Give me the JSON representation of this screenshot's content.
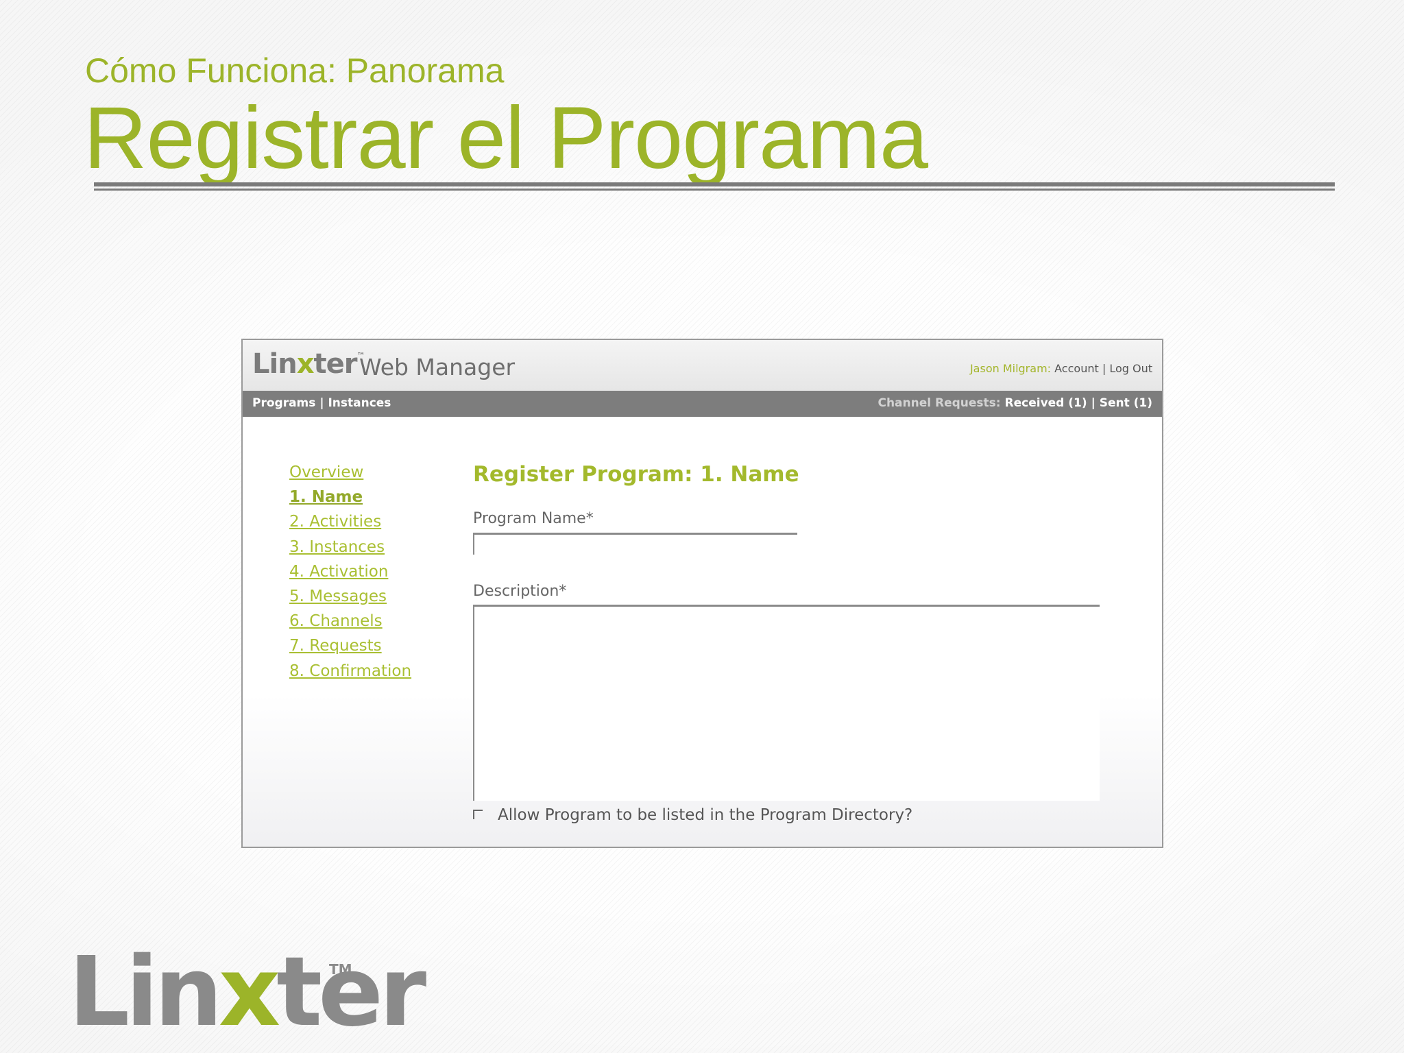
{
  "slide": {
    "subtitle": "Cómo Funciona: Panorama",
    "title": "Registrar el Programa",
    "accent_color": "#9cb429"
  },
  "web_manager": {
    "logo": {
      "prefix": "Lin",
      "x": "x",
      "suffix": "ter",
      "tm": "™"
    },
    "app_name": "Web Manager",
    "user": {
      "name": "Jason Milgram:",
      "account_link": "Account",
      "separator": "|",
      "logout_link": "Log Out"
    },
    "nav": {
      "programs": "Programs",
      "separator": "|",
      "instances": "Instances",
      "requests_label": "Channel Requests:",
      "received": "Received (1)",
      "sent": "Sent (1)"
    },
    "steps": [
      {
        "label": "Overview",
        "current": false
      },
      {
        "label": "1. Name",
        "current": true
      },
      {
        "label": "2. Activities",
        "current": false
      },
      {
        "label": "3. Instances",
        "current": false
      },
      {
        "label": "4. Activation",
        "current": false
      },
      {
        "label": "5. Messages",
        "current": false
      },
      {
        "label": "6. Channels",
        "current": false
      },
      {
        "label": "7. Requests",
        "current": false
      },
      {
        "label": "8. Confirmation",
        "current": false
      }
    ],
    "form": {
      "title": "Register Program: 1. Name",
      "program_name_label": "Program Name*",
      "program_name_value": "",
      "description_label": "Description*",
      "description_value": "",
      "directory_checkbox_label": "Allow Program to be listed in the Program Directory?",
      "directory_checked": false
    }
  },
  "brand": {
    "prefix": "Lin",
    "x": "x",
    "suffix": "ter",
    "tm": "TM"
  }
}
